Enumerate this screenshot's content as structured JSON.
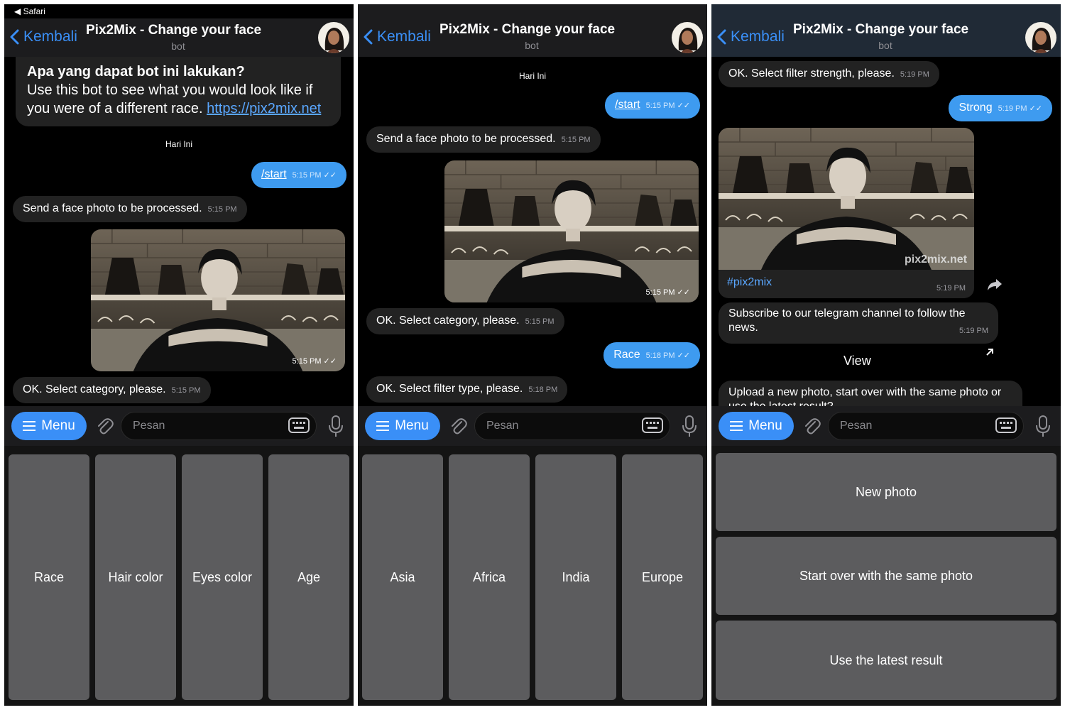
{
  "status": {
    "back_app": "◀ Safari"
  },
  "header": {
    "back_label": "Kembali",
    "title": "Pix2Mix - Change your face",
    "subtitle": "bot"
  },
  "input": {
    "menu_label": "Menu",
    "placeholder": "Pesan"
  },
  "colors": {
    "accent": "#3a8ff7",
    "outgoing_bubble": "#3e9bf0",
    "incoming_bubble": "#222222",
    "keyboard_key": "#5c5c5e"
  },
  "panel1": {
    "intro_title": "Apa yang dapat bot ini lakukan?",
    "intro_text": "Use this bot to see what you would look like if you were of a different race.",
    "intro_link": "https://pix2mix.net",
    "date": "Hari Ini",
    "start_cmd": "/start",
    "start_time": "5:15 PM",
    "send_msg": "Send a face photo to be processed.",
    "send_time": "5:15 PM",
    "photo_time": "5:15 PM",
    "category_msg": "OK. Select category, please.",
    "category_time": "5:15 PM",
    "keys": [
      "Race",
      "Hair color",
      "Eyes color",
      "Age"
    ]
  },
  "panel2": {
    "date": "Hari Ini",
    "start_cmd": "/start",
    "start_time": "5:15 PM",
    "send_msg": "Send a face photo to be processed.",
    "send_time": "5:15 PM",
    "photo_time": "5:15 PM",
    "category_msg": "OK. Select category, please.",
    "category_time": "5:15 PM",
    "race_msg": "Race",
    "race_time": "5:18 PM",
    "filter_msg": "OK. Select filter type, please.",
    "filter_time": "5:18 PM",
    "keys": [
      "Asia",
      "Africa",
      "India",
      "Europe"
    ]
  },
  "panel3": {
    "strength_msg": "OK. Select filter strength, please.",
    "strength_time": "5:19 PM",
    "strong_msg": "Strong",
    "strong_time": "5:19 PM",
    "watermark": "pix2mix.net",
    "hashtag": "#pix2mix",
    "hashtag_time": "5:19 PM",
    "subscribe_msg": "Subscribe to our telegram channel to follow the news.",
    "subscribe_time": "5:19 PM",
    "view_label": "View",
    "upload_msg": "Upload a new photo, start over with the same photo or use the latest result?",
    "keys": [
      "New photo",
      "Start over with the same photo",
      "Use the latest result"
    ]
  }
}
